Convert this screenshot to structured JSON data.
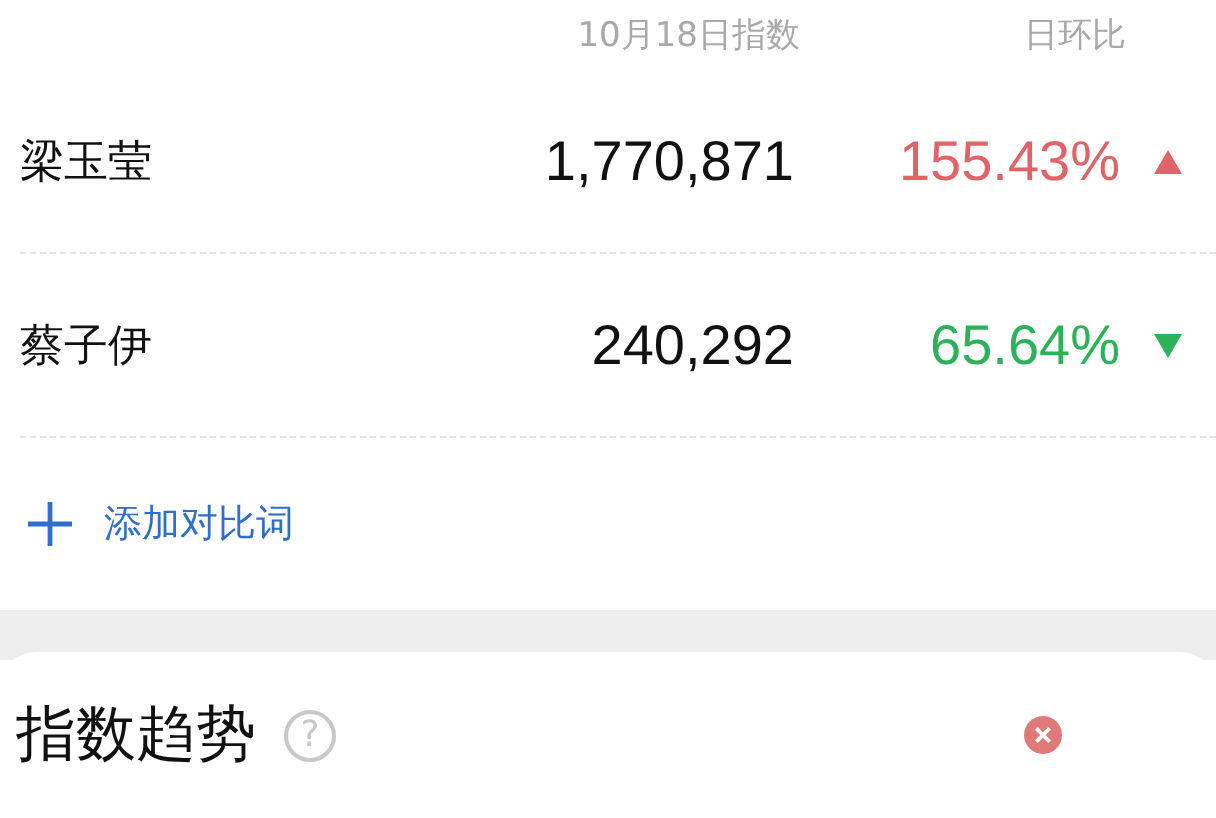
{
  "columns": [
    "10月18日指数",
    "日环比"
  ],
  "rows": [
    {
      "name": "梁玉莹",
      "index": "1,770,871",
      "change": "155.43%",
      "rising": true
    },
    {
      "name": "蔡子伊",
      "index": "240,292",
      "change": "65.64%",
      "rising": false
    }
  ],
  "add_button": {
    "label": "添加对比词"
  },
  "trend_section": {
    "title": "指数趋势",
    "help": "?"
  }
}
